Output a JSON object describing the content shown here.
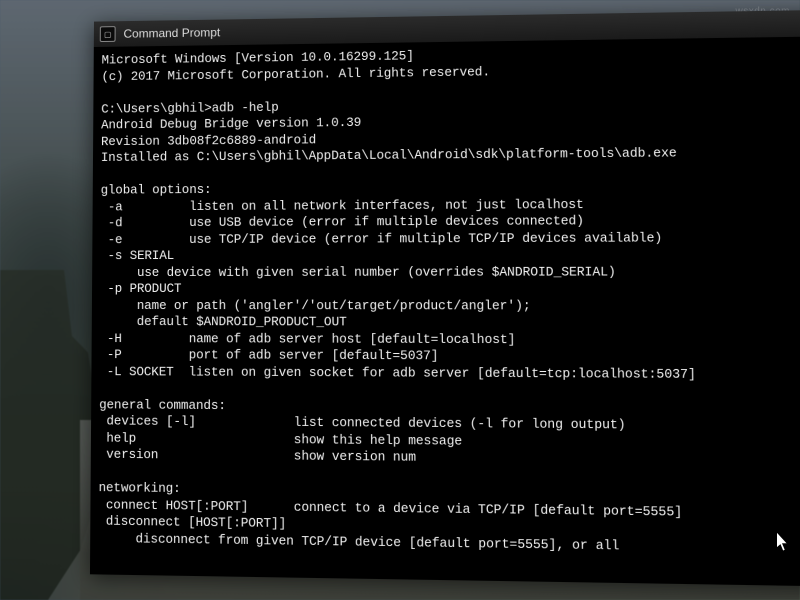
{
  "watermark": "wsxdn.com",
  "window": {
    "title": "Command Prompt",
    "icon_label": "C:\\"
  },
  "terminal": {
    "line1": "Microsoft Windows [Version 10.0.16299.125]",
    "line2": "(c) 2017 Microsoft Corporation. All rights reserved.",
    "blank1": "",
    "prompt1": "C:\\Users\\gbhil>adb -help",
    "adb1": "Android Debug Bridge version 1.0.39",
    "adb2": "Revision 3db08f2c6889-android",
    "adb3": "Installed as C:\\Users\\gbhil\\AppData\\Local\\Android\\sdk\\platform-tools\\adb.exe",
    "blank2": "",
    "gopt_hdr": "global options:",
    "gopt_a": " -a         listen on all network interfaces, not just localhost",
    "gopt_d": " -d         use USB device (error if multiple devices connected)",
    "gopt_e": " -e         use TCP/IP device (error if multiple TCP/IP devices available)",
    "gopt_s": " -s SERIAL",
    "gopt_s2": "     use device with given serial number (overrides $ANDROID_SERIAL)",
    "gopt_p": " -p PRODUCT",
    "gopt_p2": "     name or path ('angler'/'out/target/product/angler');",
    "gopt_p3": "     default $ANDROID_PRODUCT_OUT",
    "gopt_H": " -H         name of adb server host [default=localhost]",
    "gopt_P": " -P         port of adb server [default=5037]",
    "gopt_L": " -L SOCKET  listen on given socket for adb server [default=tcp:localhost:5037]",
    "blank3": "",
    "gen_hdr": "general commands:",
    "gen_dev": " devices [-l]             list connected devices (-l for long output)",
    "gen_help": " help                     show this help message",
    "gen_ver": " version                  show version num",
    "blank4": "",
    "net_hdr": "networking:",
    "net_conn": " connect HOST[:PORT]      connect to a device via TCP/IP [default port=5555]",
    "net_disc": " disconnect [HOST[:PORT]]",
    "net_disc2": "     disconnect from given TCP/IP device [default port=5555], or all"
  }
}
